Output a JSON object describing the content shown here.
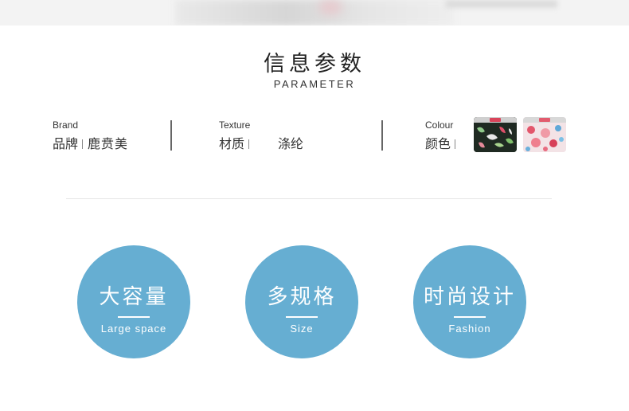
{
  "header": {
    "title": "信息参数",
    "subtitle": "PARAMETER"
  },
  "params": [
    {
      "en": "Brand",
      "label": "品牌",
      "value": "鹿贲美"
    },
    {
      "en": "Texture",
      "label": "材质",
      "value": "涤纶"
    },
    {
      "en": "Colour",
      "label": "颜色",
      "swatches": [
        "green-leaf-print-bag",
        "pink-floral-print-bag"
      ]
    }
  ],
  "features": [
    {
      "cn": "大容量",
      "en": "Large space"
    },
    {
      "cn": "多规格",
      "en": "Size"
    },
    {
      "cn": "时尚设计",
      "en": "Fashion"
    }
  ],
  "colors": {
    "accent_circle": "#66aed2",
    "text": "#333333",
    "divider": "#e6e6e6"
  }
}
